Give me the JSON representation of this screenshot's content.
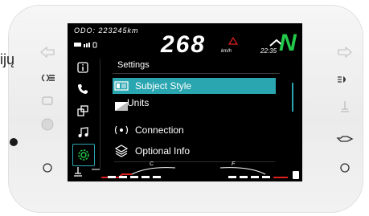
{
  "page_side_text": "ijų",
  "status": {
    "odometer": "ODO: 223245km",
    "speed": "268",
    "speed_unit": "km/h",
    "time": "22:35",
    "gear": "N"
  },
  "menu": {
    "title": "Settings",
    "items": [
      {
        "label": "Subject Style",
        "icon": "theme-icon",
        "selected": true
      },
      {
        "label": "Units",
        "icon": "flag-icon",
        "selected": false
      },
      {
        "label": "Connection",
        "icon": "connection-icon",
        "selected": false
      },
      {
        "label": "Optional Info",
        "icon": "layers-icon",
        "selected": false
      }
    ]
  },
  "gauges": {
    "temp_letter_left": "C",
    "fuel_letter": "F"
  },
  "colors": {
    "accent": "#2aa6b0",
    "gear": "#22c94a",
    "warning": "#e02020"
  }
}
